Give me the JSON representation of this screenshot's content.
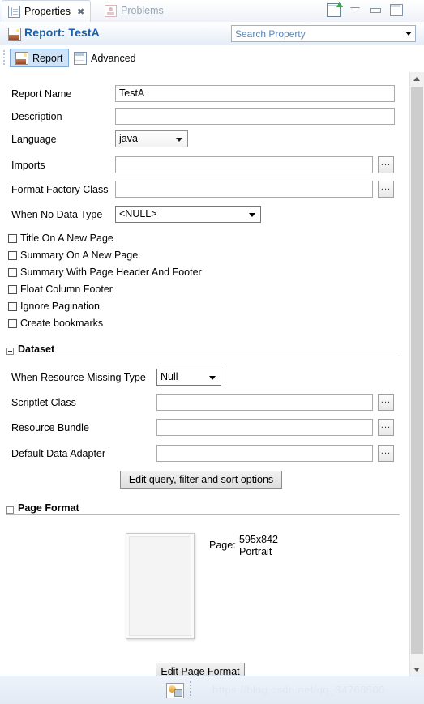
{
  "view_tabs": [
    {
      "label": "Properties",
      "icon": "properties-icon",
      "active": true,
      "closable": true
    },
    {
      "label": "Problems",
      "icon": "problems-icon",
      "active": false,
      "closable": false
    }
  ],
  "toolbar": {
    "icons": [
      {
        "name": "new-properties-view-icon",
        "title": "New Properties View"
      },
      {
        "name": "view-menu-icon",
        "title": "View Menu"
      },
      {
        "name": "minimize-icon",
        "title": "Minimize"
      },
      {
        "name": "maximize-icon",
        "title": "Maximize"
      }
    ]
  },
  "title": {
    "text": "Report: TestA",
    "icon": "report-icon",
    "color": "#1f5fa8"
  },
  "search": {
    "placeholder": "Search Property",
    "value": "",
    "dropdown_icon": "chevron-down-icon"
  },
  "inner_tabs": [
    {
      "label": "Report",
      "icon": "report-icon",
      "selected": true
    },
    {
      "label": "Advanced",
      "icon": "advanced-icon",
      "selected": false
    }
  ],
  "form": {
    "fields": [
      {
        "label": "Report Name",
        "type": "text",
        "value": "TestA"
      },
      {
        "label": "Description",
        "type": "text",
        "value": ""
      },
      {
        "label": "Language",
        "type": "combo",
        "value": "java"
      },
      {
        "label": "Imports",
        "type": "text-browse",
        "value": "",
        "browse_label": "..."
      },
      {
        "label": "Format Factory Class",
        "type": "text-browse",
        "value": "",
        "browse_label": "..."
      },
      {
        "label": "When No Data Type",
        "type": "combo-wide",
        "value": "<NULL>"
      }
    ],
    "checkboxes": [
      {
        "label": "Title On A New Page",
        "checked": false
      },
      {
        "label": "Summary On A New Page",
        "checked": false
      },
      {
        "label": "Summary With Page Header And Footer",
        "checked": false
      },
      {
        "label": "Float Column Footer",
        "checked": false
      },
      {
        "label": "Ignore Pagination",
        "checked": false
      },
      {
        "label": "Create bookmarks",
        "checked": false
      }
    ]
  },
  "dataset": {
    "section_title": "Dataset",
    "expanded": true,
    "fields": [
      {
        "label": "When Resource Missing Type",
        "type": "combo",
        "value": "Null"
      },
      {
        "label": "Scriptlet Class",
        "type": "text-browse",
        "value": "",
        "browse_label": "..."
      },
      {
        "label": "Resource Bundle",
        "type": "text-browse",
        "value": "",
        "browse_label": "..."
      },
      {
        "label": "Default Data Adapter",
        "type": "text-browse",
        "value": "",
        "browse_label": "..."
      }
    ],
    "button": "Edit query, filter and sort options"
  },
  "page_format": {
    "section_title": "Page Format",
    "expanded": true,
    "page_label": "Page:",
    "page_size": "595x842",
    "page_orientation": "Portrait",
    "button": "Edit Page Format"
  },
  "scrollbar": {
    "up_icon": "chevron-up-icon",
    "down_icon": "chevron-down-icon"
  },
  "status_bar": {
    "icon": "notification-icon",
    "watermark": "https://blog.csdn.net/qq_34766500"
  }
}
